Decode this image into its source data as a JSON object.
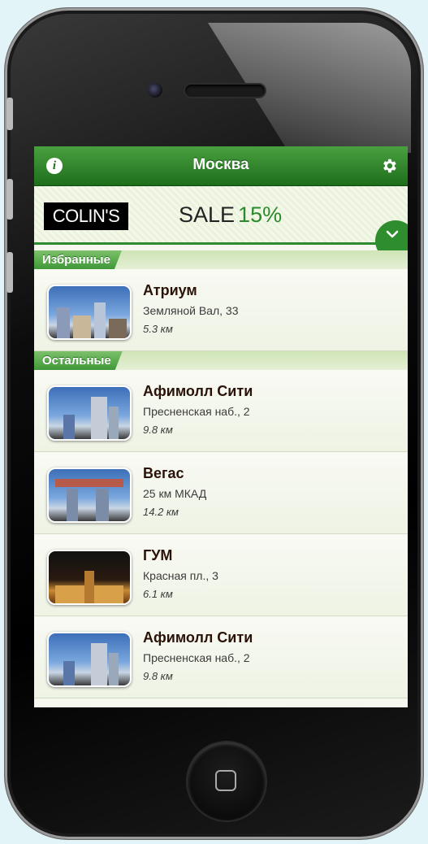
{
  "navbar": {
    "title": "Москва",
    "info_label": "i",
    "info_icon": "info-icon",
    "settings_icon": "gear-icon"
  },
  "banner": {
    "brand": "COLIN'S",
    "sale_text": "SALE",
    "sale_percent": "15%",
    "expand_icon": "chevron-down-icon"
  },
  "sections": {
    "favorites_label": "Избранные",
    "others_label": "Остальные"
  },
  "favorites": [
    {
      "name": "Атриум",
      "address": "Земляной Вал, 33",
      "distance": "5.3 км"
    }
  ],
  "others": [
    {
      "name": "Афимолл Сити",
      "address": "Пресненская наб., 2",
      "distance": "9.8 км"
    },
    {
      "name": "Вегас",
      "address": "25 км МКАД",
      "distance": "14.2 км"
    },
    {
      "name": "ГУМ",
      "address": "Красная пл., 3",
      "distance": "6.1 км"
    },
    {
      "name": "Афимолл Сити",
      "address": "Пресненская наб., 2",
      "distance": "9.8 км"
    }
  ],
  "colors": {
    "nav_green": "#1d6e1b",
    "accent_green": "#2b8a2b",
    "background": "#e3f4f8"
  }
}
